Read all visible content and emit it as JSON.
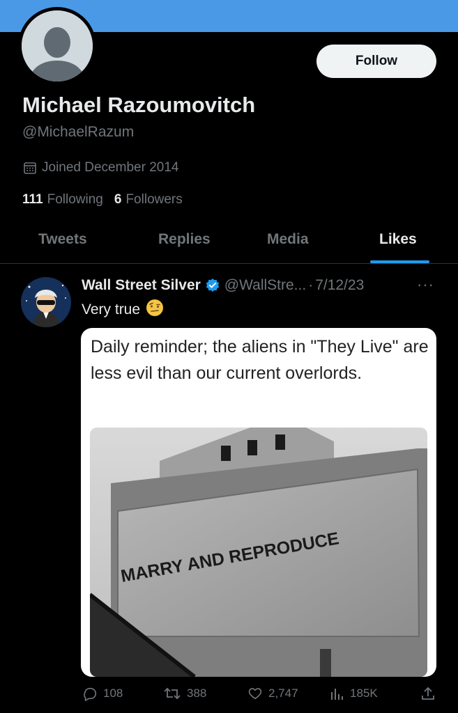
{
  "colors": {
    "banner": "#4a99e6",
    "accent": "#1d9bf0",
    "text": "#e7e9ea",
    "muted": "#71767b",
    "background": "#000000"
  },
  "profile": {
    "follow_label": "Follow",
    "name": "Michael Razoumovitch",
    "handle": "@MichaelRazum",
    "joined": "Joined December 2014",
    "following_count": "111",
    "following_label": "Following",
    "followers_count": "6",
    "followers_label": "Followers"
  },
  "tabs": [
    {
      "label": "Tweets",
      "active": false
    },
    {
      "label": "Replies",
      "active": false
    },
    {
      "label": "Media",
      "active": false
    },
    {
      "label": "Likes",
      "active": true
    }
  ],
  "tweet": {
    "author_name": "Wall Street Silver",
    "author_handle": "@WallStre...",
    "separator": "·",
    "date": "7/12/23",
    "text": "Very true",
    "emoji": "🤨",
    "card_caption": "Daily reminder; the aliens in \"They Live\" are less evil than our current overlords.",
    "photo_sign_text": "MARRY AND REPRODUCE",
    "more_icon": "ellipsis-icon",
    "actions": {
      "replies": "108",
      "retweets": "388",
      "likes": "2,747",
      "views": "185K"
    }
  }
}
